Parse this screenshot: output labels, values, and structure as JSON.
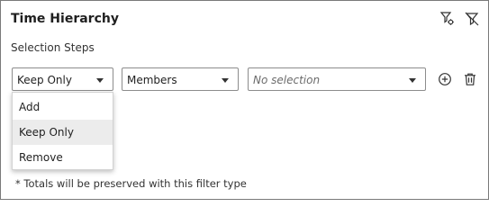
{
  "panel": {
    "title": "Time Hierarchy",
    "subtitle": "Selection Steps",
    "footnote": "* Totals will be preserved with this filter type"
  },
  "header_icons": [
    "filter-settings-icon",
    "clear-filter-icon"
  ],
  "controls": {
    "action_select": {
      "value": "Keep Only"
    },
    "type_select": {
      "value": "Members"
    },
    "selection_select": {
      "placeholder": "No selection"
    }
  },
  "row_icons": [
    "add-circle-icon",
    "delete-trash-icon"
  ],
  "dropdown": {
    "options": [
      {
        "label": "Add",
        "selected": false
      },
      {
        "label": "Keep Only",
        "selected": true
      },
      {
        "label": "Remove",
        "selected": false
      }
    ]
  }
}
